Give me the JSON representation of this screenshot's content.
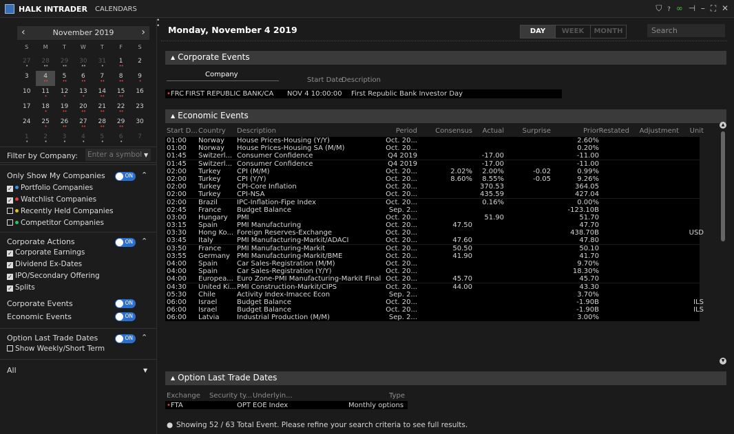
{
  "app": {
    "name": "HALK INTRADER",
    "tab": "CALENDARS"
  },
  "calendar": {
    "month": "November 2019",
    "weekdays": [
      "S",
      "M",
      "T",
      "W",
      "T",
      "F",
      "S"
    ],
    "weeks": [
      [
        {
          "d": "27",
          "dim": true,
          "dots": "•"
        },
        {
          "d": "28",
          "dim": true,
          "dots": "••"
        },
        {
          "d": "29",
          "dim": true,
          "dots": "••"
        },
        {
          "d": "30",
          "dim": true,
          "dots": "••"
        },
        {
          "d": "31",
          "dim": true,
          "dots": "•"
        },
        {
          "d": "1",
          "dots": "••"
        },
        {
          "d": "2",
          "dots": ""
        }
      ],
      [
        {
          "d": "3",
          "dots": ""
        },
        {
          "d": "4",
          "sel": true,
          "dots": "••"
        },
        {
          "d": "5",
          "dots": "••"
        },
        {
          "d": "6",
          "dots": "••"
        },
        {
          "d": "7",
          "dots": "••"
        },
        {
          "d": "8",
          "dots": "••"
        },
        {
          "d": "9",
          "dots": "•"
        }
      ],
      [
        {
          "d": "10",
          "dots": ""
        },
        {
          "d": "11",
          "dots": "•"
        },
        {
          "d": "12",
          "dots": "•"
        },
        {
          "d": "13",
          "dots": "•"
        },
        {
          "d": "14",
          "dots": "••"
        },
        {
          "d": "15",
          "dots": "••"
        },
        {
          "d": "16",
          "dots": ""
        }
      ],
      [
        {
          "d": "17",
          "dots": ""
        },
        {
          "d": "18",
          "dots": "•"
        },
        {
          "d": "19",
          "dots": "••"
        },
        {
          "d": "20",
          "dots": "••"
        },
        {
          "d": "21",
          "dots": "••"
        },
        {
          "d": "22",
          "dots": "••"
        },
        {
          "d": "23",
          "dots": ""
        }
      ],
      [
        {
          "d": "24",
          "dots": ""
        },
        {
          "d": "25",
          "dots": "•"
        },
        {
          "d": "26",
          "dots": "••"
        },
        {
          "d": "27",
          "dots": "••"
        },
        {
          "d": "28",
          "dots": "••"
        },
        {
          "d": "29",
          "dots": "••"
        },
        {
          "d": "30",
          "dots": ""
        }
      ],
      [
        {
          "d": "1",
          "dim": true,
          "dots": "•"
        },
        {
          "d": "2",
          "dim": true,
          "dots": "•"
        },
        {
          "d": "3",
          "dim": true,
          "dots": "•"
        },
        {
          "d": "4",
          "dim": true,
          "dots": "•"
        },
        {
          "d": "5",
          "dim": true,
          "dots": "•"
        },
        {
          "d": "6",
          "dim": true,
          "dots": "•"
        },
        {
          "d": "7",
          "dim": true,
          "dots": ""
        }
      ]
    ]
  },
  "filter": {
    "label": "Filter by Company:",
    "placeholder": "Enter a symbol"
  },
  "my_companies": {
    "title": "Only Show My Companies",
    "toggle": "ON",
    "items": [
      {
        "label": "Portfolio Companies",
        "checked": true,
        "color": "#3d8fe0"
      },
      {
        "label": "Watchlist Companies",
        "checked": true,
        "color": "#e04040"
      },
      {
        "label": "Recently Held Companies",
        "checked": false,
        "color": "#e0c020"
      },
      {
        "label": "Competitor Companies",
        "checked": false,
        "color": "#30c060"
      }
    ]
  },
  "corporate_actions": {
    "title": "Corporate Actions",
    "toggle": "ON",
    "items": [
      "Corporate Earnings",
      "Dividend Ex-Dates",
      "IPO/Secondary Offering",
      "Splits"
    ]
  },
  "toggles": [
    {
      "label": "Corporate Events",
      "value": "ON"
    },
    {
      "label": "Economic Events",
      "value": "ON"
    }
  ],
  "option_dates": {
    "title": "Option Last Trade Dates",
    "toggle": "ON",
    "check": "Show Weekly/Short Term"
  },
  "all_select": "All",
  "main": {
    "date": "Monday, November 4 2019",
    "views": [
      "DAY",
      "WEEK",
      "MONTH"
    ],
    "active_view": "DAY",
    "search_placeholder": "Search"
  },
  "corporate_events": {
    "title": "Corporate Events",
    "headers": [
      "Company",
      "Start Date",
      "Description"
    ],
    "row": {
      "symbol": "FRC",
      "company": "FIRST REPUBLIC BANK/CA",
      "start": "NOV 4 10:00:00",
      "description": "First Republic Bank Investor Day"
    }
  },
  "economic_events": {
    "title": "Economic Events",
    "headers": [
      "Start D...",
      "Country",
      "Description",
      "Period",
      "Consensus",
      "Actual",
      "Surprise",
      "Prior",
      "Restated",
      "Adjustment",
      "Unit"
    ],
    "rows": [
      [
        "01:00",
        "Norway",
        "House Prices-Housing (Y/Y)",
        "Oct. 20...",
        "",
        "",
        "",
        "2.60%",
        "",
        "",
        ""
      ],
      [
        "01:00",
        "Norway",
        "House Prices-Housing SA (M/M)",
        "Oct. 20...",
        "",
        "",
        "",
        "0.20%",
        "",
        "",
        ""
      ],
      [
        "01:45",
        "Switzerl...",
        "Consumer Confidence",
        "Q4 2019",
        "",
        "-17.00",
        "",
        "-11.00",
        "",
        "",
        ""
      ],
      [
        "01:45",
        "Switzerl...",
        "Consumer Confidence",
        "Q4 2019",
        "",
        "-17.00",
        "",
        "-11.00",
        "",
        "",
        ""
      ],
      [
        "02:00",
        "Turkey",
        "CPI (M/M)",
        "Oct. 20...",
        "2.02%",
        "2.00%",
        "-0.02",
        "0.99%",
        "",
        "",
        ""
      ],
      [
        "02:00",
        "Turkey",
        "CPI (Y/Y)",
        "Oct. 20...",
        "8.60%",
        "8.55%",
        "-0.05",
        "9.26%",
        "",
        "",
        ""
      ],
      [
        "02:00",
        "Turkey",
        "CPI-Core Inflation",
        "Oct. 20...",
        "",
        "370.53",
        "",
        "364.05",
        "",
        "",
        ""
      ],
      [
        "02:00",
        "Turkey",
        "CPI-NSA",
        "Oct. 20...",
        "",
        "435.59",
        "",
        "427.04",
        "",
        "",
        ""
      ],
      [
        "02:00",
        "Brazil",
        "IPC-Inflation-Fipe Index",
        "Oct. 20...",
        "",
        "0.16%",
        "",
        "0.00%",
        "",
        "",
        ""
      ],
      [
        "02:45",
        "France",
        "Budget Balance",
        "Sep. 2...",
        "",
        "",
        "",
        "-123.10B",
        "",
        "",
        ""
      ],
      [
        "03:00",
        "Hungary",
        "PMI",
        "Oct. 20...",
        "",
        "51.90",
        "",
        "51.70",
        "",
        "",
        ""
      ],
      [
        "03:15",
        "Spain",
        "PMI Manufacturing",
        "Oct. 20...",
        "47.50",
        "",
        "",
        "47.70",
        "",
        "",
        ""
      ],
      [
        "03:30",
        "Hong Ko...",
        "Foreign Reserves-Exchange",
        "Oct. 20...",
        "",
        "",
        "",
        "438.70B",
        "",
        "",
        "USD"
      ],
      [
        "03:45",
        "Italy",
        "PMI Manufacturing-Markit/ADACI",
        "Oct. 20...",
        "47.60",
        "",
        "",
        "47.80",
        "",
        "",
        ""
      ],
      [
        "03:50",
        "France",
        "PMI Manufacturing-Markit",
        "Oct. 20...",
        "50.50",
        "",
        "",
        "50.10",
        "",
        "",
        ""
      ],
      [
        "03:55",
        "Germany",
        "PMI Manufacturing-Markit/BME",
        "Oct. 20...",
        "41.90",
        "",
        "",
        "41.70",
        "",
        "",
        ""
      ],
      [
        "04:00",
        "Spain",
        "Car Sales-Registration (M/M)",
        "Oct. 20...",
        "",
        "",
        "",
        "9.70%",
        "",
        "",
        ""
      ],
      [
        "04:00",
        "Spain",
        "Car Sales-Registration (Y/Y)",
        "Oct. 20...",
        "",
        "",
        "",
        "18.30%",
        "",
        "",
        ""
      ],
      [
        "04:00",
        "Europea...",
        "Euro Zone-PMI Manufacturing-Markit Final",
        "Oct. 20...",
        "45.70",
        "",
        "",
        "45.70",
        "",
        "",
        ""
      ],
      [
        "04:30",
        "United Ki...",
        "PMI Construction-Markit/CIPS",
        "Oct. 20...",
        "44.00",
        "",
        "",
        "43.30",
        "",
        "",
        ""
      ],
      [
        "05:30",
        "Chile",
        "Activity Index-Imacec Econ",
        "Sep. 2...",
        "",
        "",
        "",
        "3.70%",
        "",
        "",
        ""
      ],
      [
        "06:00",
        "Israel",
        "Budget Balance",
        "Oct. 20...",
        "",
        "",
        "",
        "-1.90B",
        "",
        "",
        "ILS"
      ],
      [
        "06:00",
        "Israel",
        "Budget Balance",
        "Oct. 20...",
        "",
        "",
        "",
        "-1.90B",
        "",
        "",
        "ILS"
      ],
      [
        "06:00",
        "Latvia",
        "Industrial Production (M/M)",
        "Sep. 2...",
        "",
        "",
        "",
        "3.00%",
        "",
        "",
        ""
      ]
    ]
  },
  "option_section": {
    "title": "Option Last Trade Dates",
    "headers": [
      "Exchange",
      "Security ty...",
      "Underlyin...",
      "Type"
    ],
    "row": {
      "exchange": "FTA",
      "security": "OPT",
      "underlying": "EOE Index",
      "type": "Monthly options"
    }
  },
  "footer": "Showing 52 / 63 Total Event. Please refine your search criteria to see full results."
}
